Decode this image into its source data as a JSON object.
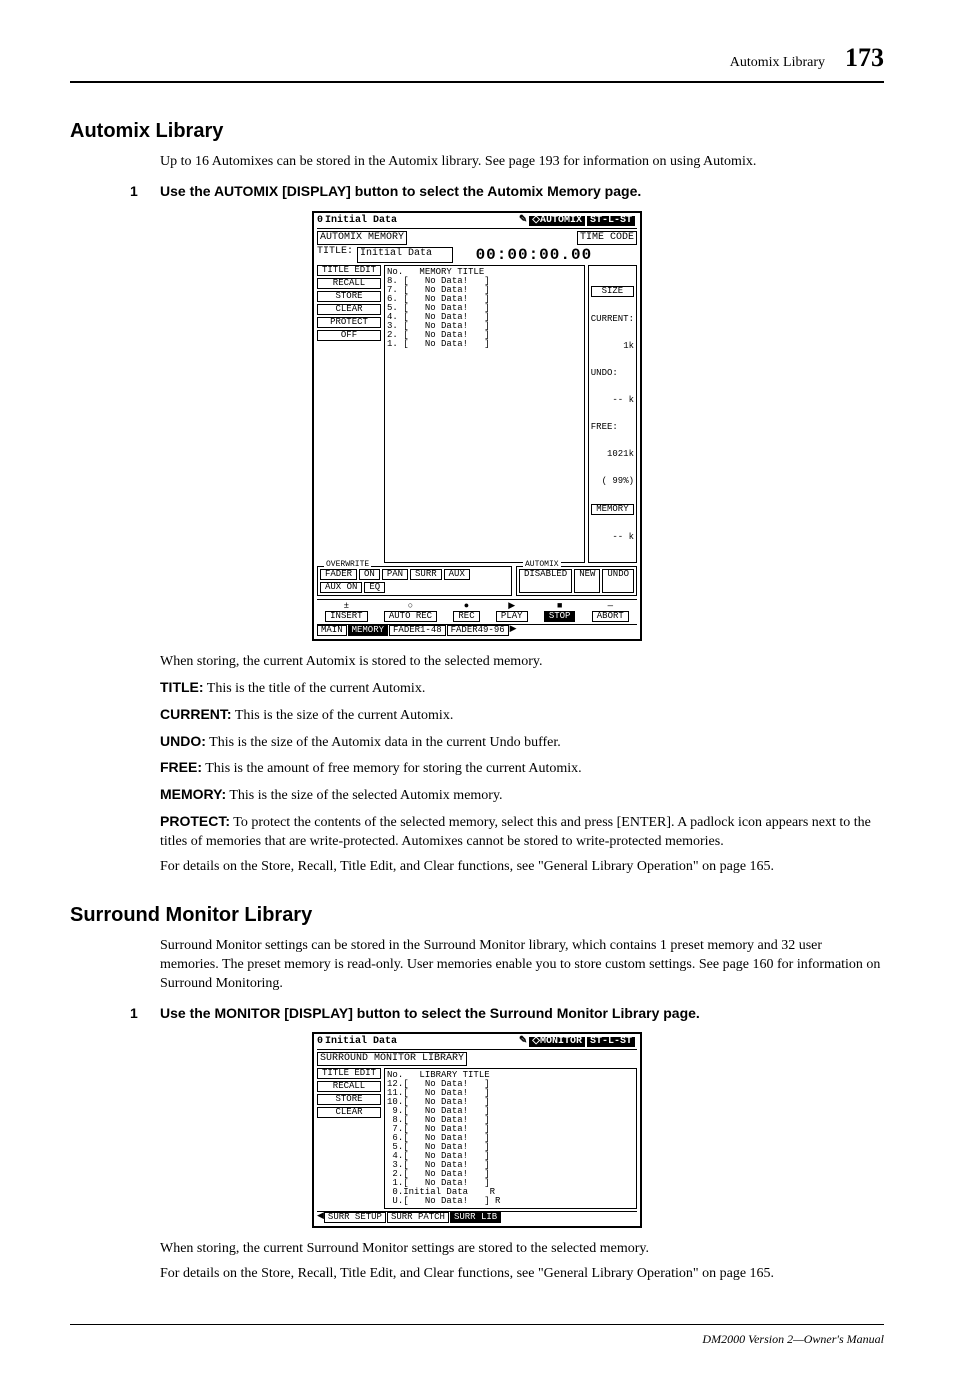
{
  "header": {
    "section": "Automix Library",
    "page": "173"
  },
  "section1": {
    "title": "Automix Library",
    "intro": "Up to 16 Automixes can be stored in the Automix library. See page 193 for information on using Automix.",
    "step_num": "1",
    "step_text": "Use the AUTOMIX [DISPLAY] button to select the Automix Memory page.",
    "after_shot": "When storing, the current Automix is stored to the selected memory.",
    "defs": {
      "title_lbl": "TITLE:",
      "title_txt": "This is the title of the current Automix.",
      "current_lbl": "CURRENT:",
      "current_txt": "This is the size of the current Automix.",
      "undo_lbl": "UNDO:",
      "undo_txt": "This is the size of the Automix data in the current Undo buffer.",
      "free_lbl": "FREE:",
      "free_txt": "This is the amount of free memory for storing the current Automix.",
      "memory_lbl": "MEMORY:",
      "memory_txt": "This is the size of the selected Automix memory.",
      "protect_lbl": "PROTECT:",
      "protect_txt": "To protect the contents of the selected memory, select this and press [ENTER]. A padlock icon appears next to the titles of memories that are write-protected. Automixes cannot be stored to write-protected memories."
    },
    "note": "For details on the Store, Recall, Title Edit, and Clear functions, see \"General Library Operation\" on page 165."
  },
  "automix_screen": {
    "idx": "0",
    "title": "Initial Data",
    "mode": "AUTOMIX",
    "stereo": "ST-L-ST",
    "mem_label": "AUTOMIX MEMORY",
    "time_label": "TIME CODE",
    "timecode": "00:00:00.00",
    "title_label": "TITLE:",
    "title_value": "Initial Data",
    "list_hdr": "No.   MEMORY TITLE",
    "buttons": [
      "TITLE EDIT",
      "RECALL",
      "STORE",
      "CLEAR",
      "PROTECT",
      "OFF"
    ],
    "list": [
      "8. [   No Data!   ]",
      "7. [   No Data!   ]",
      "6. [   No Data!   ]",
      "5. [   No Data!   ]",
      "4. [   No Data!   ]",
      "3. [   No Data!   ]",
      "2. [   No Data!   ]",
      "1. [   No Data!   ]"
    ],
    "size": {
      "label": "SIZE",
      "current_lbl": "CURRENT:",
      "current_val": "1k",
      "undo_lbl": "UNDO:",
      "undo_val": "-- k",
      "free_lbl": "FREE:",
      "free_val": "1021k",
      "free_pct": "( 99%)",
      "mem_lbl": "MEMORY",
      "mem_val": "-- k"
    },
    "overwrite": {
      "label": "OVERWRITE",
      "items": [
        "FADER",
        "ON",
        "PAN",
        "SURR",
        "AUX",
        "AUX ON",
        "EQ"
      ]
    },
    "automix_box": {
      "label": "AUTOMIX",
      "state": "DISABLED",
      "new": "NEW",
      "undo": "UNDO"
    },
    "transport": [
      "INSERT",
      "AUTO REC",
      "REC",
      "PLAY",
      "STOP",
      "ABORT"
    ],
    "tabs": [
      "MAIN",
      "MEMORY",
      "FADER1-48",
      "FADER49-96"
    ]
  },
  "section2": {
    "title": "Surround Monitor Library",
    "intro": "Surround Monitor settings can be stored in the Surround Monitor library, which contains 1 preset memory and 32 user memories. The preset memory is read-only. User memories enable you to store custom settings. See page 160 for information on Surround Monitoring.",
    "step_num": "1",
    "step_text": "Use the MONITOR [DISPLAY] button to select the Surround Monitor Library page.",
    "after_shot": "When storing, the current Surround Monitor settings are stored to the selected memory.",
    "note": "For details on the Store, Recall, Title Edit, and Clear functions, see \"General Library Operation\" on page 165."
  },
  "monitor_screen": {
    "idx": "0",
    "title": "Initial Data",
    "mode": "MONITOR",
    "stereo": "ST-L-ST",
    "lib_label": "SURROUND MONITOR LIBRARY",
    "list_hdr": "No.   LIBRARY TITLE",
    "buttons": [
      "TITLE EDIT",
      "RECALL",
      "STORE",
      "CLEAR"
    ],
    "list": [
      "12.[   No Data!   ]",
      "11.[   No Data!   ]",
      "10.[   No Data!   ]",
      " 9.[   No Data!   ]",
      " 8.[   No Data!   ]",
      " 7.[   No Data!   ]",
      " 6.[   No Data!   ]",
      " 5.[   No Data!   ]",
      " 4.[   No Data!   ]",
      " 3.[   No Data!   ]",
      " 2.[   No Data!   ]",
      " 1.[   No Data!   ]",
      " 0.Initial Data    R",
      " U.[   No Data!   ] R"
    ],
    "tabs": [
      "SURR SETUP",
      "SURR PATCH",
      "SURR LIB"
    ]
  },
  "footer": "DM2000 Version 2—Owner's Manual"
}
